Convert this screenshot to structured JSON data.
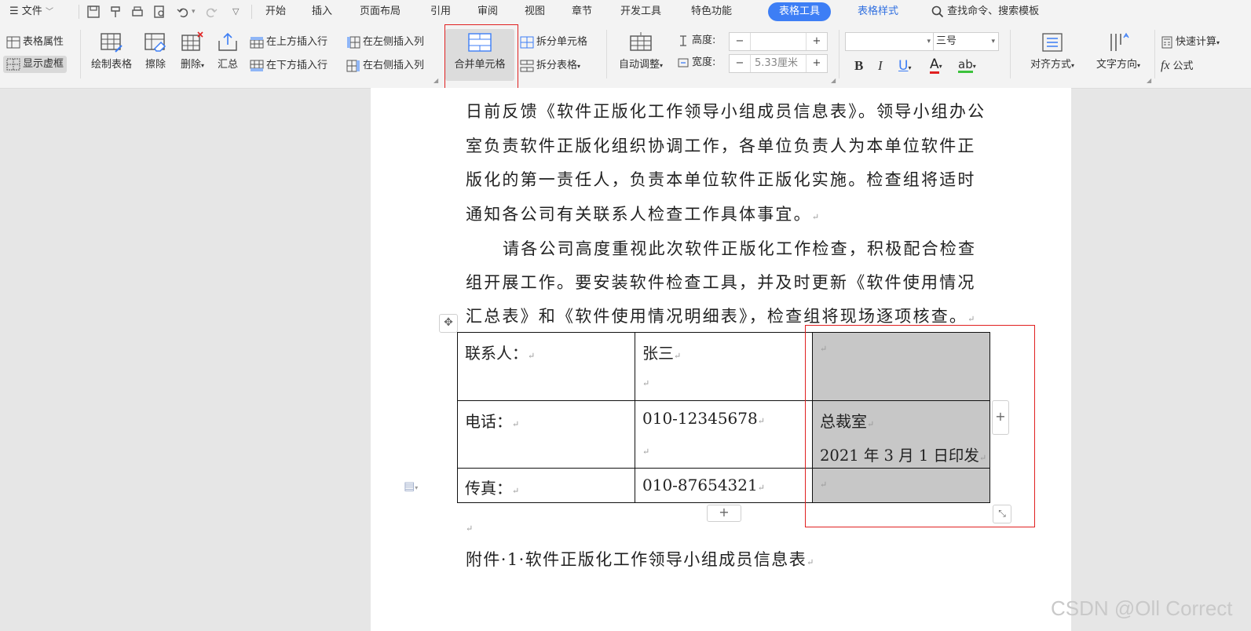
{
  "menu": {
    "file": "文件",
    "tabs": [
      "开始",
      "插入",
      "页面布局",
      "引用",
      "审阅",
      "视图",
      "章节",
      "开发工具",
      "特色功能"
    ],
    "active_tab": "表格工具",
    "secondary_tab": "表格样式",
    "search": "查找命令、搜索模板"
  },
  "ribbon": {
    "table_props": "表格属性",
    "show_gridlines": "显示虚框",
    "draw_table": "绘制表格",
    "erase": "擦除",
    "delete": "删除",
    "summary": "汇总",
    "insert_above": "在上方插入行",
    "insert_below": "在下方插入行",
    "insert_left": "在左侧插入列",
    "insert_right": "在右侧插入列",
    "merge_cells": "合并单元格",
    "split_cells": "拆分单元格",
    "split_table": "拆分表格",
    "auto_fit": "自动调整",
    "height_label": "高度:",
    "height_value": "",
    "width_label": "宽度:",
    "width_value": "5.33厘米",
    "font_name": "",
    "font_size": "三号",
    "bold": "B",
    "italic": "I",
    "underline": "U",
    "font_color": "A",
    "highlight": "ab",
    "align": "对齐方式",
    "text_direction": "文字方向",
    "quick_calc": "快速计算",
    "formula": "公式",
    "formula_icon": "fx"
  },
  "document": {
    "lines": [
      "日前反馈《软件正版化工作领导小组成员信息表》。领导小组办公",
      "室负责软件正版化组织协调工作，各单位负责人为本单位软件正",
      "版化的第一责任人，负责本单位软件正版化实施。检查组将适时",
      "通知各公司有关联系人检查工作具体事宜。",
      "请各公司高度重视此次软件正版化工作检查，积极配合检查",
      "组开展工作。要安装软件检查工具，并及时更新《软件使用情况",
      "汇总表》和《软件使用情况明细表》，检查组将现场逐项核查。"
    ],
    "table": {
      "r1c1": "联系人：",
      "r1c2": "张三",
      "r2c1": "电话：",
      "r2c2": "010-12345678",
      "r2c3a": "总裁室",
      "r2c3b": "2021 年 3 月 1 日印发",
      "r3c1": "传真：",
      "r3c2": "010-87654321"
    },
    "attachment": "附件·1·软件正版化工作领导小组成员信息表"
  },
  "colors": {
    "accent": "#3d7ef5",
    "highlight_red": "#e02020",
    "cell_shade": "#c7c7c7"
  },
  "watermark": "CSDN @Oll Correct"
}
